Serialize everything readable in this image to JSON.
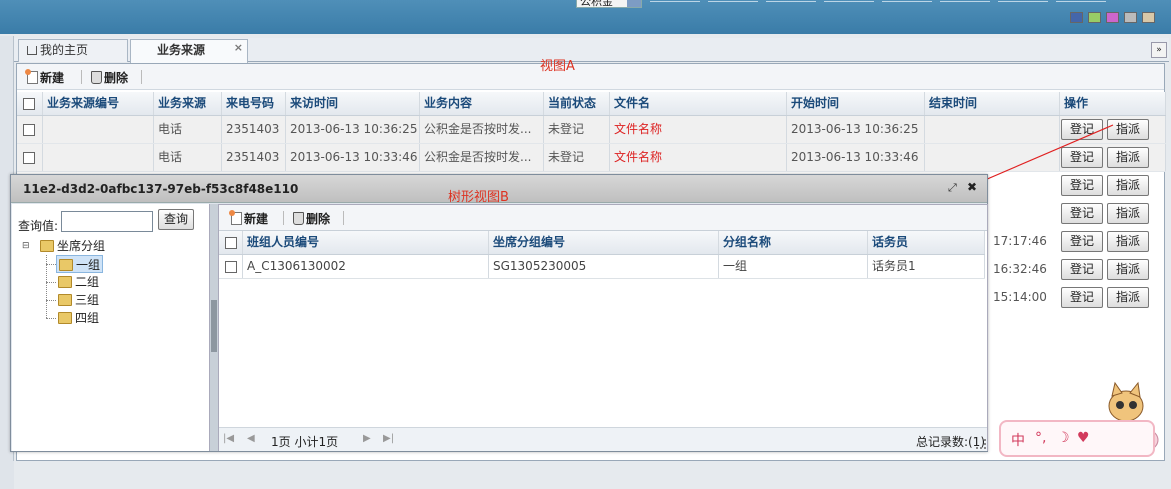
{
  "header": {
    "fund_select_value": "公积金",
    "theme_colors": [
      "#4466aa",
      "#99cc66",
      "#cc66cc",
      "#bbbbbb",
      "#d8c8a8"
    ]
  },
  "tabs": {
    "home": "我的主页",
    "active": "业务来源",
    "close_glyph": "×",
    "menu_glyph": "»"
  },
  "main": {
    "toolbar": {
      "new_label": "新建",
      "delete_label": "删除"
    },
    "view_label": "视图A",
    "columns": [
      "业务来源编号",
      "业务来源",
      "来电号码",
      "来访时间",
      "业务内容",
      "当前状态",
      "文件名",
      "开始时间",
      "结束时间",
      "操作"
    ],
    "rows": [
      {
        "id": "",
        "source": "电话",
        "phone": "2351403",
        "visit_time": "2013-06-13 10:36:25",
        "content": "公积金是否按时发...",
        "status": "未登记",
        "file": "文件名称",
        "start": "2013-06-13 10:36:25",
        "end": ""
      },
      {
        "id": "",
        "source": "电话",
        "phone": "2351403",
        "visit_time": "2013-06-13 10:33:46",
        "content": "公积金是否按时发...",
        "status": "未登记",
        "file": "文件名称",
        "start": "2013-06-13 10:33:46",
        "end": ""
      }
    ],
    "partial_times": [
      "",
      "",
      "17:17:46",
      "16:32:46",
      "15:14:00"
    ],
    "action_register": "登记",
    "action_assign": "指派"
  },
  "dialog": {
    "title": "11e2-d3d2-0afbc137-97eb-f53c8f48e110",
    "tree_label": "树形视图B",
    "max_glyph": "⤢",
    "close_glyph": "✖",
    "query_label": "查询值:",
    "query_value": "",
    "query_button": "查询",
    "tree_root": "坐席分组",
    "tree_children": [
      "一组",
      "二组",
      "三组",
      "四组"
    ],
    "toolbar": {
      "new_label": "新建",
      "delete_label": "删除"
    },
    "columns": [
      "班组人员编号",
      "坐席分组编号",
      "分组名称",
      "话务员"
    ],
    "rows": [
      {
        "staff_id": "A_C1306130002",
        "group_id": "SG1305230005",
        "group_name": "一组",
        "operator": "话务员1"
      }
    ],
    "pager": {
      "first": "|◀",
      "prev": "◀",
      "info": "1页 小计1页",
      "next": "▶",
      "last": "▶|",
      "total": "总记录数:(1)"
    }
  },
  "ime": {
    "mode": "中",
    "punct": "°,",
    "moon": "☽",
    "heart": "♥"
  }
}
